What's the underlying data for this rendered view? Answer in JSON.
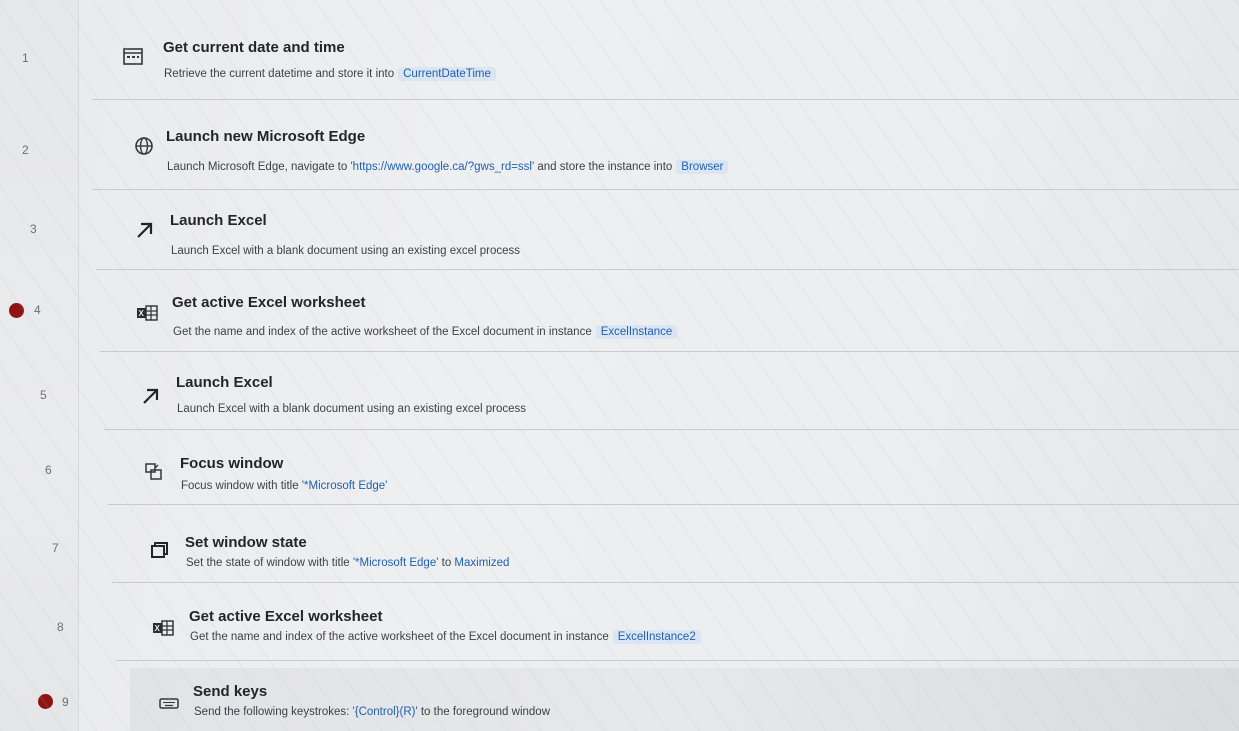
{
  "actions": [
    {
      "num": "1",
      "icon": "calendar-icon",
      "title": "Get current date and time",
      "desc": "Retrieve the current datetime and store it into",
      "var": "CurrentDateTime"
    },
    {
      "num": "2",
      "icon": "globe-icon",
      "title": "Launch new Microsoft Edge",
      "desc": "Launch Microsoft Edge, navigate to",
      "literal": "'https://www.google.ca/?gws_rd=ssl'",
      "desc2": "and store the instance into",
      "var": "Browser"
    },
    {
      "num": "3",
      "icon": "launch-arrow-icon",
      "title": "Launch Excel",
      "desc": "Launch Excel with a blank document using an existing excel process"
    },
    {
      "num": "4",
      "icon": "excel-worksheet-icon",
      "breakpoint": true,
      "title": "Get active Excel worksheet",
      "desc": "Get the name and index of the active worksheet of the Excel document in instance",
      "var": "ExcelInstance"
    },
    {
      "num": "5",
      "icon": "launch-arrow-icon",
      "title": "Launch Excel",
      "desc": "Launch Excel with a blank document using an existing excel process"
    },
    {
      "num": "6",
      "icon": "focus-window-icon",
      "title": "Focus window",
      "desc": "Focus window with title",
      "literal": "'*Microsoft Edge'"
    },
    {
      "num": "7",
      "icon": "window-state-icon",
      "title": "Set window state",
      "desc": "Set the state of window with title",
      "literal": "'*Microsoft Edge'",
      "desc2": "to",
      "literal2": "Maximized"
    },
    {
      "num": "8",
      "icon": "excel-worksheet-icon",
      "title": "Get active Excel worksheet",
      "desc": "Get the name and index of the active worksheet of the Excel document in instance",
      "var": "ExcelInstance2"
    },
    {
      "num": "9",
      "icon": "keyboard-icon",
      "breakpoint": true,
      "title": "Send keys",
      "desc": "Send the following keystrokes:",
      "literal": "'{Control}(R)'",
      "desc2": "to the foreground window"
    }
  ],
  "colors": {
    "breakpoint": "#8e1414",
    "token_bg": "#dbe6f4",
    "token_text": "#1f5fb0"
  }
}
